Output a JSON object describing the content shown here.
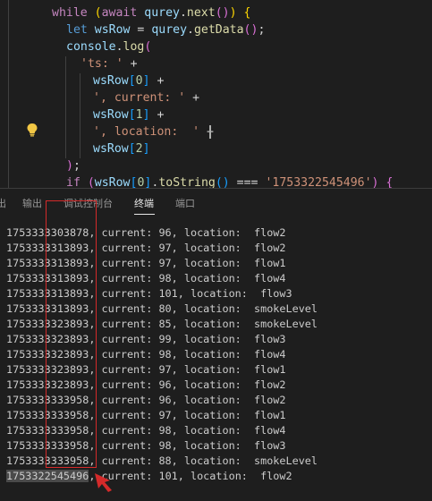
{
  "editor": {
    "lines": [
      {
        "tokens": [
          [
            "kw",
            "while"
          ],
          [
            "pun",
            " "
          ],
          [
            "brk1",
            "("
          ],
          [
            "kw",
            "await"
          ],
          [
            "pun",
            " "
          ],
          [
            "var",
            "qurey"
          ],
          [
            "pun",
            "."
          ],
          [
            "fn",
            "next"
          ],
          [
            "brk2",
            "()"
          ],
          [
            "brk1",
            ")"
          ],
          [
            "pun",
            " "
          ],
          [
            "brk1",
            "{"
          ]
        ]
      },
      {
        "tokens": [
          [
            "kw2",
            "let"
          ],
          [
            "pun",
            " "
          ],
          [
            "var",
            "wsRow"
          ],
          [
            "pun",
            " = "
          ],
          [
            "var",
            "qurey"
          ],
          [
            "pun",
            "."
          ],
          [
            "fn",
            "getData"
          ],
          [
            "brk2",
            "()"
          ],
          [
            "pun",
            ";"
          ]
        ]
      },
      {
        "tokens": [
          [
            "var",
            "console"
          ],
          [
            "pun",
            "."
          ],
          [
            "fn",
            "log"
          ],
          [
            "brk2",
            "("
          ]
        ]
      },
      {
        "tokens": [
          [
            "str",
            "'ts: '"
          ],
          [
            "pun",
            " +"
          ]
        ]
      },
      {
        "tokens": [
          [
            "var",
            "wsRow"
          ],
          [
            "brk3",
            "["
          ],
          [
            "num",
            "0"
          ],
          [
            "brk3",
            "]"
          ],
          [
            "pun",
            " +"
          ]
        ]
      },
      {
        "tokens": [
          [
            "str",
            "', current: '"
          ],
          [
            "pun",
            " +"
          ]
        ]
      },
      {
        "tokens": [
          [
            "var",
            "wsRow"
          ],
          [
            "brk3",
            "["
          ],
          [
            "num",
            "1"
          ],
          [
            "brk3",
            "]"
          ],
          [
            "pun",
            " +"
          ]
        ]
      },
      {
        "tokens": [
          [
            "str",
            "', location:  '"
          ],
          [
            "pun",
            " +"
          ]
        ]
      },
      {
        "tokens": [
          [
            "var",
            "wsRow"
          ],
          [
            "brk3",
            "["
          ],
          [
            "num",
            "2"
          ],
          [
            "brk3",
            "]"
          ]
        ]
      },
      {
        "tokens": [
          [
            "brk2",
            ")"
          ],
          [
            "pun",
            ";"
          ]
        ]
      },
      {
        "tokens": [
          [
            "kw",
            "if"
          ],
          [
            "pun",
            " "
          ],
          [
            "brk2",
            "("
          ],
          [
            "var",
            "wsRow"
          ],
          [
            "brk3",
            "["
          ],
          [
            "num",
            "0"
          ],
          [
            "brk3",
            "]"
          ],
          [
            "pun",
            "."
          ],
          [
            "fn",
            "toString"
          ],
          [
            "brk3",
            "()"
          ],
          [
            "pun",
            " === "
          ],
          [
            "str",
            "'1753322545496'"
          ],
          [
            "brk2",
            ")"
          ],
          [
            "pun",
            " "
          ],
          [
            "brk2",
            "{"
          ]
        ]
      }
    ]
  },
  "tabs": [
    {
      "label": "出",
      "active": false
    },
    {
      "label": "输出",
      "active": false
    },
    {
      "label": "调试控制台",
      "active": false
    },
    {
      "label": "终端",
      "active": true
    },
    {
      "label": "端口",
      "active": false
    }
  ],
  "terminal": {
    "lines": [
      "1753333303878, current: 96, location:  flow2",
      "1753333313893, current: 97, location:  flow2",
      "1753333313893, current: 97, location:  flow1",
      "1753333313893, current: 98, location:  flow4",
      "1753333313893, current: 101, location:  flow3",
      "1753333313893, current: 80, location:  smokeLevel",
      "1753333323893, current: 85, location:  smokeLevel",
      "1753333323893, current: 99, location:  flow3",
      "1753333323893, current: 98, location:  flow4",
      "1753333323893, current: 97, location:  flow1",
      "1753333323893, current: 96, location:  flow2",
      "1753333333958, current: 96, location:  flow2",
      "1753333333958, current: 97, location:  flow1",
      "1753333333958, current: 98, location:  flow4",
      "1753333333958, current: 98, location:  flow3",
      "1753333333958, current: 88, location:  smokeLevel"
    ],
    "last_line": {
      "ts": "1753322545496",
      "rest": ", current: 101, location:  flow2"
    }
  },
  "colors": {
    "annotation_red": "#d42a2a",
    "background": "#1e1e1e"
  }
}
